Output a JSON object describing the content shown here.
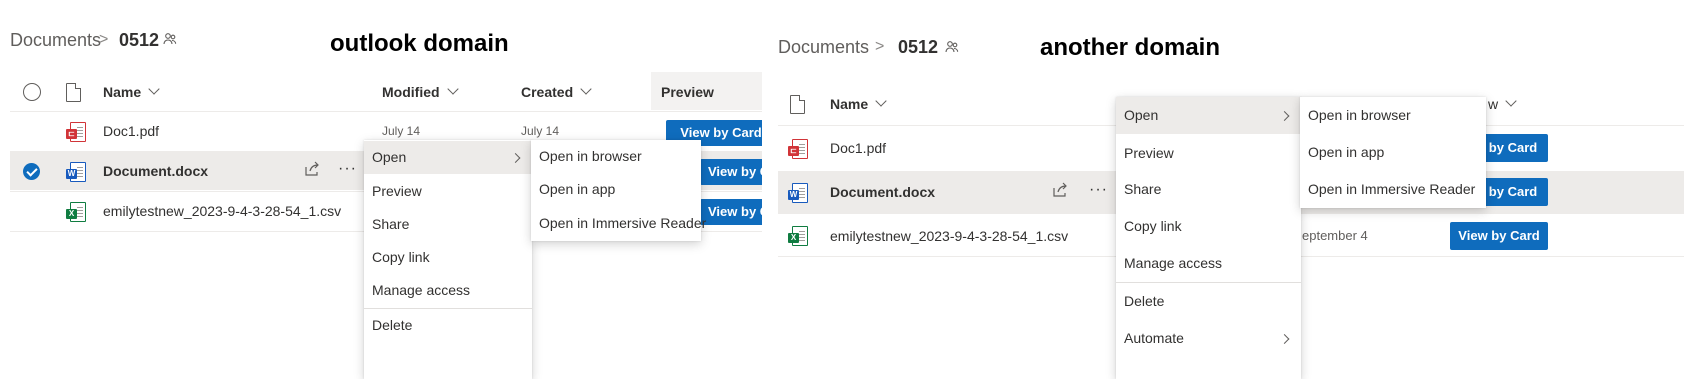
{
  "panels": [
    {
      "breadcrumb": {
        "root": "Documents",
        "separator": ">",
        "current": "0512"
      },
      "caption": "outlook domain",
      "columns": {
        "name": "Name",
        "modified": "Modified",
        "created": "Created",
        "preview": "Preview"
      },
      "files": [
        {
          "name": "Doc1.pdf",
          "type": "pdf",
          "modified": "July 14",
          "created": "July 14",
          "button": "View by Card"
        },
        {
          "name": "Document.docx",
          "type": "docx",
          "selected": true,
          "button": "View by Card"
        },
        {
          "name": "emilytestnew_2023-9-4-3-28-54_1.csv",
          "type": "csv",
          "button": "View by Card"
        }
      ],
      "context_menu": [
        "Open",
        "Preview",
        "Share",
        "Copy link",
        "Manage access",
        "Delete"
      ],
      "submenu": [
        "Open in browser",
        "Open in app",
        "Open in Immersive Reader"
      ]
    },
    {
      "breadcrumb": {
        "root": "Documents",
        "separator": ">",
        "current": "0512"
      },
      "caption": "another domain",
      "columns": {
        "name": "Name",
        "view": "w"
      },
      "files": [
        {
          "name": "Doc1.pdf",
          "type": "pdf",
          "button": "by Card"
        },
        {
          "name": "Document.docx",
          "type": "docx",
          "selected": true,
          "button": "by Card"
        },
        {
          "name": "emilytestnew_2023-9-4-3-28-54_1.csv",
          "type": "csv",
          "date": "eptember 4",
          "button": "View by Card"
        }
      ],
      "context_menu": [
        "Open",
        "Preview",
        "Share",
        "Copy link",
        "Manage access",
        "Delete",
        "Automate"
      ],
      "submenu": [
        "Open in browser",
        "Open in app",
        "Open in Immersive Reader"
      ]
    }
  ],
  "icons": {
    "file_header": "document-icon",
    "shared": "people-icon",
    "share": "share-icon",
    "more": "more-icon"
  },
  "colors": {
    "accent": "#0f6cbd",
    "selected_row": "#edebe9",
    "pdf": "#d13438",
    "word": "#185abd",
    "excel": "#107c41"
  }
}
